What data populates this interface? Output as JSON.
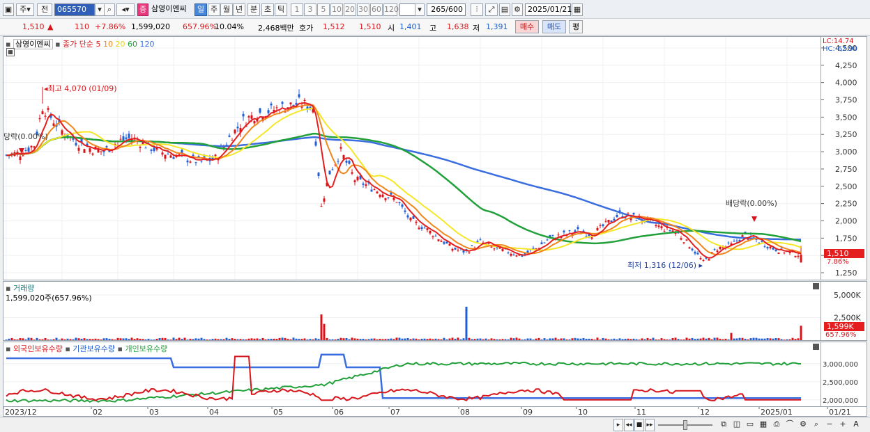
{
  "toolbar": {
    "type_label": "주",
    "prev_label": "전",
    "code": "065570",
    "name_badge": "증",
    "stock_name": "삼영이엔씨",
    "periods": [
      "일",
      "주",
      "월",
      "년",
      "분",
      "초",
      "틱"
    ],
    "numbers": [
      "1",
      "3",
      "5",
      "10",
      "20",
      "30",
      "60",
      "120"
    ],
    "count": "265",
    "count_total": "/600",
    "date": "2025/01/21"
  },
  "info": {
    "price": "1,510",
    "arrow": "▲",
    "change": "110",
    "change_pct": "+7.86%",
    "volume": "1,599,020",
    "vol_pct": "657.96%",
    "turnover": "10.04%",
    "amount": "2,468백만",
    "hoga_label": "호가",
    "ask": "1,512",
    "bid": "1,510",
    "open_label": "시",
    "open": "1,401",
    "high_label": "고",
    "high": "1,638",
    "low_label": "저",
    "low": "1,391",
    "buy": "매수",
    "sell": "매도",
    "eval": "평"
  },
  "price_panel": {
    "name": "삼영이엔씨",
    "ma_label": "종가 단순",
    "ma_periods": [
      "5",
      "10",
      "20",
      "60",
      "120"
    ],
    "lc": "LC:14.74",
    "hc": "HC:-62.90",
    "price_tag": "1,510",
    "pct_tag": "7.86%",
    "high_annot": "최고 4,070 (01/09)",
    "low_annot": "최저 1,316 (12/06)",
    "div_left": "당락(0.00%)",
    "div_right": "배당락(0.00%)"
  },
  "volume_panel": {
    "title": "거래량",
    "value": "1,599,020주(657.96%)",
    "tag": "1,599K",
    "tag_pct": "657.96%"
  },
  "holders_panel": {
    "legend": [
      "외국인보유수량",
      "기관보유수량",
      "개인보유수량"
    ]
  },
  "colors": {
    "up": "#d7141a",
    "down": "#1f5fd1",
    "ma5": "#e41e1e",
    "ma10": "#f0861c",
    "ma20": "#f5e626",
    "ma60": "#22a039",
    "ma120": "#3a6de0"
  },
  "chart_data": {
    "type": "line",
    "price_axis": {
      "ticks": [
        "4,500",
        "4,250",
        "4,000",
        "3,750",
        "3,500",
        "3,250",
        "3,000",
        "2,750",
        "2,500",
        "2,250",
        "2,000",
        "1,750",
        "1,500",
        "1,250"
      ],
      "ylim": [
        1200,
        4600
      ]
    },
    "volume_axis": {
      "ticks": [
        "5,000K",
        "2,500K"
      ]
    },
    "holders_axis": {
      "ticks": [
        "3,000,000",
        "2,500,000",
        "2,000,000"
      ]
    },
    "x_labels": [
      "2023/12",
      "02",
      "03",
      "04",
      "05",
      "06",
      "07",
      "08",
      "09",
      "10",
      "11",
      "12",
      "2025/01",
      "01/21"
    ],
    "price_series_approx": [
      [
        0,
        2950
      ],
      [
        5,
        2980
      ],
      [
        10,
        3100
      ],
      [
        13,
        3650
      ],
      [
        16,
        3500
      ],
      [
        20,
        3300
      ],
      [
        25,
        3150
      ],
      [
        30,
        3050
      ],
      [
        35,
        3000
      ],
      [
        40,
        3150
      ],
      [
        45,
        3200
      ],
      [
        50,
        3100
      ],
      [
        55,
        3000
      ],
      [
        60,
        2950
      ],
      [
        65,
        2900
      ],
      [
        70,
        2850
      ],
      [
        75,
        2900
      ],
      [
        80,
        3200
      ],
      [
        85,
        3450
      ],
      [
        90,
        3550
      ],
      [
        95,
        3600
      ],
      [
        100,
        3650
      ],
      [
        105,
        3700
      ],
      [
        110,
        3650
      ],
      [
        113,
        2200
      ],
      [
        116,
        2700
      ],
      [
        120,
        3000
      ],
      [
        125,
        2600
      ],
      [
        130,
        2500
      ],
      [
        135,
        2400
      ],
      [
        140,
        2300
      ],
      [
        145,
        2000
      ],
      [
        150,
        1900
      ],
      [
        155,
        1750
      ],
      [
        160,
        1600
      ],
      [
        165,
        1550
      ],
      [
        170,
        1700
      ],
      [
        175,
        1600
      ],
      [
        180,
        1550
      ],
      [
        185,
        1500
      ],
      [
        190,
        1600
      ],
      [
        195,
        1750
      ],
      [
        200,
        1800
      ],
      [
        205,
        1850
      ],
      [
        210,
        1800
      ],
      [
        215,
        1950
      ],
      [
        220,
        2100
      ],
      [
        225,
        2050
      ],
      [
        230,
        2000
      ],
      [
        235,
        1900
      ],
      [
        240,
        1850
      ],
      [
        245,
        1650
      ],
      [
        250,
        1400
      ],
      [
        255,
        1600
      ],
      [
        260,
        1650
      ],
      [
        265,
        1800
      ],
      [
        270,
        1700
      ],
      [
        275,
        1600
      ],
      [
        280,
        1550
      ],
      [
        285,
        1510
      ]
    ],
    "volume_spikes_K": [
      [
        113,
        2850
      ],
      [
        114,
        1800
      ],
      [
        165,
        3700
      ],
      [
        260,
        800
      ],
      [
        285,
        1599
      ]
    ]
  }
}
